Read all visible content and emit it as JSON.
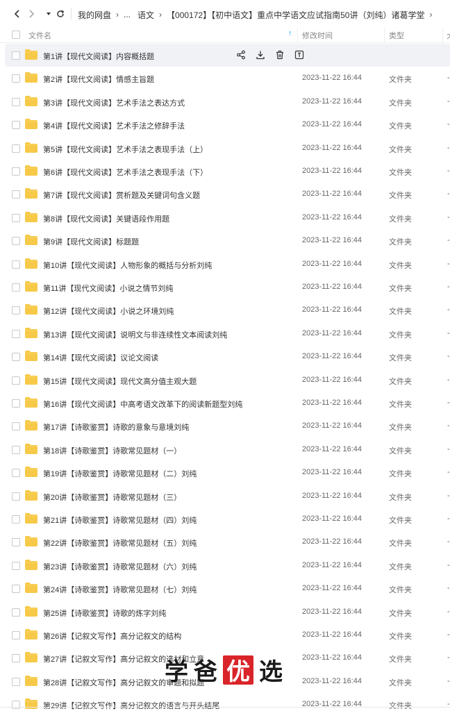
{
  "nav": {
    "breadcrumbs": [
      "我的网盘",
      "...",
      "语文",
      "【000172】【初中语文】重点中学语文应试指南50讲（刘纯）诸葛学堂"
    ]
  },
  "header": {
    "name_label": "文件名",
    "time_label": "修改时间",
    "type_label": "类型",
    "size_label": "大"
  },
  "colors": {
    "folder": "#f7c948",
    "accent": "#06a7ff"
  },
  "files": [
    {
      "name": "第1讲【现代文阅读】内容概括题",
      "time": "",
      "type": "",
      "size": ""
    },
    {
      "name": "第2讲【现代文阅读】情感主旨题",
      "time": "2023-11-22 16:44",
      "type": "文件夹",
      "size": "-"
    },
    {
      "name": "第3讲【现代文阅读】艺术手法之表达方式",
      "time": "2023-11-22 16:44",
      "type": "文件夹",
      "size": "-"
    },
    {
      "name": "第4讲【现代文阅读】艺术手法之修辞手法",
      "time": "2023-11-22 16:44",
      "type": "文件夹",
      "size": "-"
    },
    {
      "name": "第5讲【现代文阅读】艺术手法之表现手法（上）",
      "time": "2023-11-22 16:44",
      "type": "文件夹",
      "size": "-"
    },
    {
      "name": "第6讲【现代文阅读】艺术手法之表现手法（下）",
      "time": "2023-11-22 16:44",
      "type": "文件夹",
      "size": "-"
    },
    {
      "name": "第7讲【现代文阅读】赏析题及关键词句含义题",
      "time": "2023-11-22 16:44",
      "type": "文件夹",
      "size": "-"
    },
    {
      "name": "第8讲【现代文阅读】关键语段作用题",
      "time": "2023-11-22 16:44",
      "type": "文件夹",
      "size": "-"
    },
    {
      "name": "第9讲【现代文阅读】标题题",
      "time": "2023-11-22 16:44",
      "type": "文件夹",
      "size": "-"
    },
    {
      "name": "第10讲【现代文阅读】人物形象的概括与分析刘纯",
      "time": "2023-11-22 16:44",
      "type": "文件夹",
      "size": "-"
    },
    {
      "name": "第11讲【现代文阅读】小说之情节刘纯",
      "time": "2023-11-22 16:44",
      "type": "文件夹",
      "size": "-"
    },
    {
      "name": "第12讲【现代文阅读】小说之环境刘纯",
      "time": "2023-11-22 16:44",
      "type": "文件夹",
      "size": "-"
    },
    {
      "name": "第13讲【现代文阅读】说明文与非连续性文本阅读刘纯",
      "time": "2023-11-22 16:44",
      "type": "文件夹",
      "size": "-"
    },
    {
      "name": "第14讲【现代文阅读】议论文阅读",
      "time": "2023-11-22 16:44",
      "type": "文件夹",
      "size": "-"
    },
    {
      "name": "第15讲【现代文阅读】现代文高分值主观大题",
      "time": "2023-11-22 16:44",
      "type": "文件夹",
      "size": "-"
    },
    {
      "name": "第16讲【现代文阅读】中高考语文改革下的阅读新题型刘纯",
      "time": "2023-11-22 16:44",
      "type": "文件夹",
      "size": "-"
    },
    {
      "name": "第17讲【诗歌鉴赏】诗歌的意象与意境刘纯",
      "time": "2023-11-22 16:44",
      "type": "文件夹",
      "size": "-"
    },
    {
      "name": "第18讲【诗歌鉴赏】诗歌常见题材（一）",
      "time": "2023-11-22 16:44",
      "type": "文件夹",
      "size": "-"
    },
    {
      "name": "第19讲【诗歌鉴赏】诗歌常见题材（二）刘纯",
      "time": "2023-11-22 16:44",
      "type": "文件夹",
      "size": "-"
    },
    {
      "name": "第20讲【诗歌鉴赏】诗歌常见题材（三）",
      "time": "2023-11-22 16:44",
      "type": "文件夹",
      "size": "-"
    },
    {
      "name": "第21讲【诗歌鉴赏】诗歌常见题材（四）刘纯",
      "time": "2023-11-22 16:44",
      "type": "文件夹",
      "size": "-"
    },
    {
      "name": "第22讲【诗歌鉴赏】诗歌常见题材（五）刘纯",
      "time": "2023-11-22 16:44",
      "type": "文件夹",
      "size": "-"
    },
    {
      "name": "第23讲【诗歌鉴赏】诗歌常见题材（六）刘纯",
      "time": "2023-11-22 16:44",
      "type": "文件夹",
      "size": "-"
    },
    {
      "name": "第24讲【诗歌鉴赏】诗歌常见题材（七）刘纯",
      "time": "2023-11-22 16:44",
      "type": "文件夹",
      "size": "-"
    },
    {
      "name": "第25讲【诗歌鉴赏】诗歌的炼字刘纯",
      "time": "2023-11-22 16:44",
      "type": "文件夹",
      "size": "-"
    },
    {
      "name": "第26讲【记叙文写作】高分记叙文的结构",
      "time": "2023-11-22 16:44",
      "type": "文件夹",
      "size": "-"
    },
    {
      "name": "第27讲【记叙文写作】高分记叙文的选材和立意",
      "time": "2023-11-22 16:44",
      "type": "文件夹",
      "size": "-"
    },
    {
      "name": "第28讲【记叙文写作】高分记叙文的审题和拟题",
      "time": "2023-11-22 16:44",
      "type": "文件夹",
      "size": "-"
    },
    {
      "name": "第29讲【记叙文写作】高分记叙文的语言与开头结尾",
      "time": "2023-11-22 16:44",
      "type": "文件夹",
      "size": "-"
    }
  ],
  "watermark": {
    "chars": [
      "学",
      "爸",
      "优",
      "选"
    ]
  }
}
